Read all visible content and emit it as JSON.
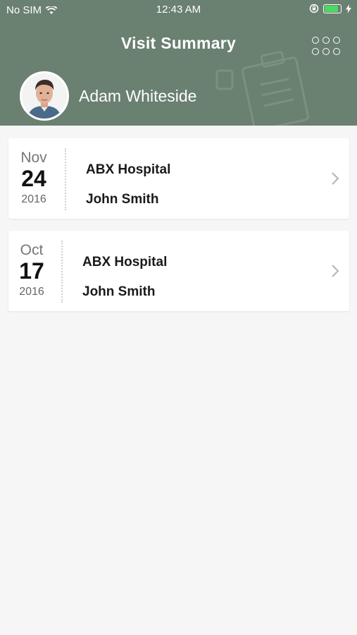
{
  "status_bar": {
    "carrier": "No SIM",
    "time": "12:43 AM",
    "battery_color": "#4cd964",
    "battery_level": 0.8
  },
  "header": {
    "title": "Visit Summary",
    "user_name": "Adam Whiteside",
    "background_color": "#6a8071",
    "menu_icon": "grid-dots-icon"
  },
  "visits": [
    {
      "month": "Nov",
      "day": "24",
      "year": "2016",
      "hospital": "ABX Hospital",
      "doctor": "John Smith"
    },
    {
      "month": "Oct",
      "day": "17",
      "year": "2016",
      "hospital": "ABX Hospital",
      "doctor": "John Smith"
    }
  ]
}
